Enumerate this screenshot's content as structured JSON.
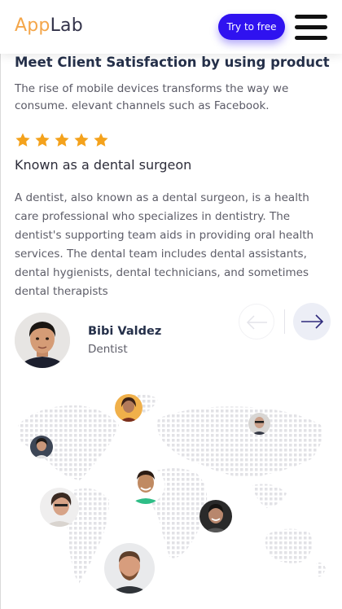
{
  "header": {
    "logo_part1": "App",
    "logo_part2": "Lab",
    "cta_label": "Try to free",
    "menu_icon": "hamburger-icon"
  },
  "section": {
    "title": "Meet Client Satisfaction by using product",
    "lead": "The rise of mobile devices transforms the way we consume. elevant channels such as Facebook."
  },
  "testimonial": {
    "rating": 5,
    "heading": "Known as a dental surgeon",
    "text": "A dentist, also known as a dental surgeon, is a health care professional who specializes in dentistry. The dentist's supporting team aids in providing oral health services. The dental team includes dental assistants, dental hygienists, dental technicians, and sometimes dental therapists",
    "author_name": "Bibi Valdez",
    "author_role": "Dentist"
  },
  "nav": {
    "prev_icon": "arrow-left-icon",
    "next_icon": "arrow-right-icon"
  },
  "colors": {
    "accent": "#2f12f0",
    "logo_orange": "#f4a64a",
    "star": "#f4a21c",
    "heading": "#25304a"
  }
}
